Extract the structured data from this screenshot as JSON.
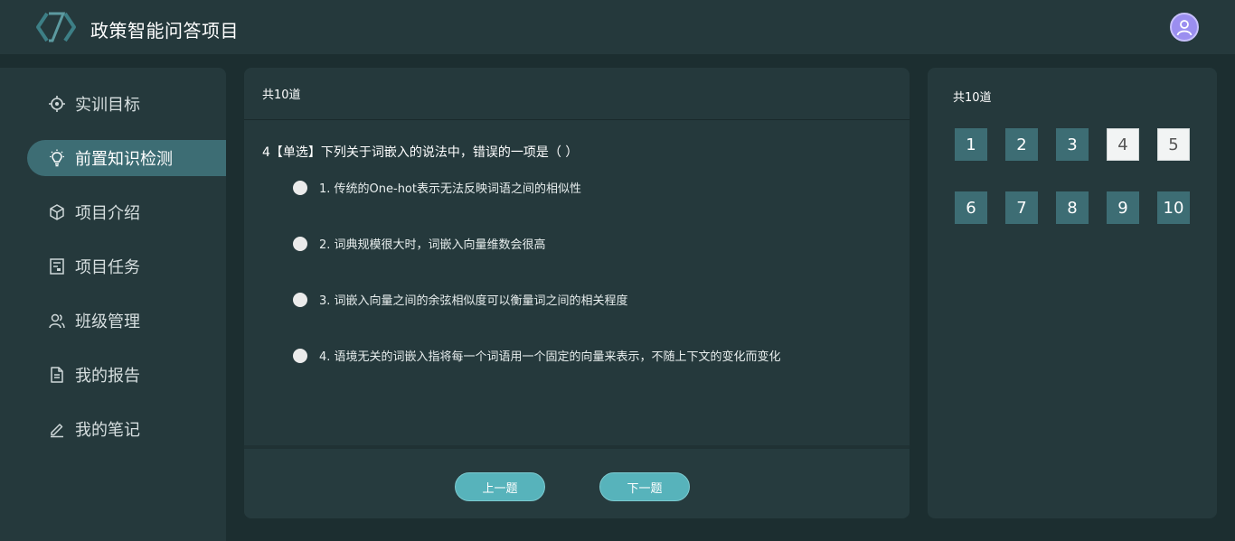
{
  "app": {
    "title": "政策智能问答项目",
    "colors": {
      "accent": "#3d6d74",
      "button": "#57b3bb",
      "panel": "#25393c",
      "background": "#1c2e30"
    }
  },
  "header": {
    "avatar_icon": "user-avatar-icon"
  },
  "sidebar": {
    "items": [
      {
        "label": "实训目标",
        "icon": "target-icon"
      },
      {
        "label": "前置知识检测",
        "icon": "lightbulb-icon",
        "active": true
      },
      {
        "label": "项目介绍",
        "icon": "cube-icon"
      },
      {
        "label": "项目任务",
        "icon": "task-icon"
      },
      {
        "label": "班级管理",
        "icon": "users-icon"
      },
      {
        "label": "我的报告",
        "icon": "document-icon"
      },
      {
        "label": "我的笔记",
        "icon": "pen-icon"
      }
    ]
  },
  "main": {
    "header": "共10道",
    "question": "4【单选】下列关于词嵌入的说法中，错误的一项是（ ）",
    "options": [
      "1. 传统的One-hot表示无法反映词语之间的相似性",
      "2. 词典规模很大时，词嵌入向量维数会很高",
      "3. 词嵌入向量之间的余弦相似度可以衡量词之间的相关程度",
      "4. 语境无关的词嵌入指将每一个词语用一个固定的向量来表示，不随上下文的变化而变化"
    ],
    "prev_label": "上一题",
    "next_label": "下一题"
  },
  "panel": {
    "header": "共10道",
    "numbers": [
      "1",
      "2",
      "3",
      "4",
      "5",
      "6",
      "7",
      "8",
      "9",
      "10"
    ]
  }
}
